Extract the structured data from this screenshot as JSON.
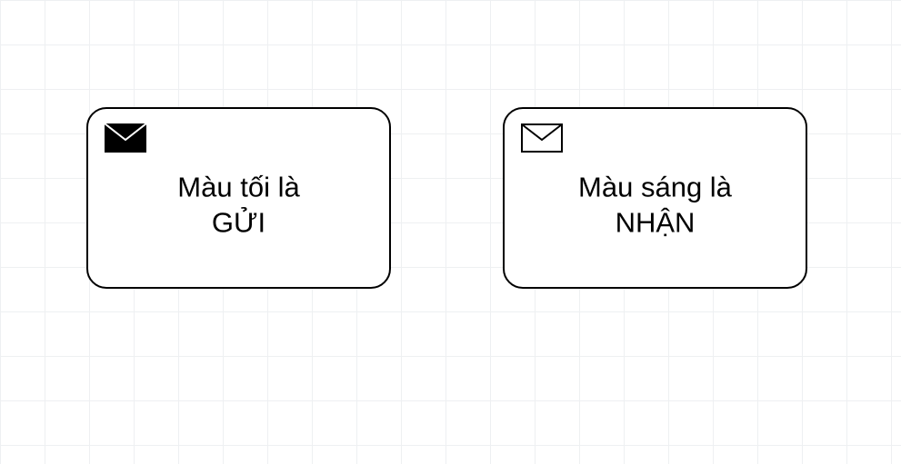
{
  "nodes": {
    "send": {
      "label": "Màu tối là\nGỬI",
      "icon": "envelope-filled"
    },
    "receive": {
      "label": "Màu sáng là\nNHẬN",
      "icon": "envelope-outline"
    }
  }
}
